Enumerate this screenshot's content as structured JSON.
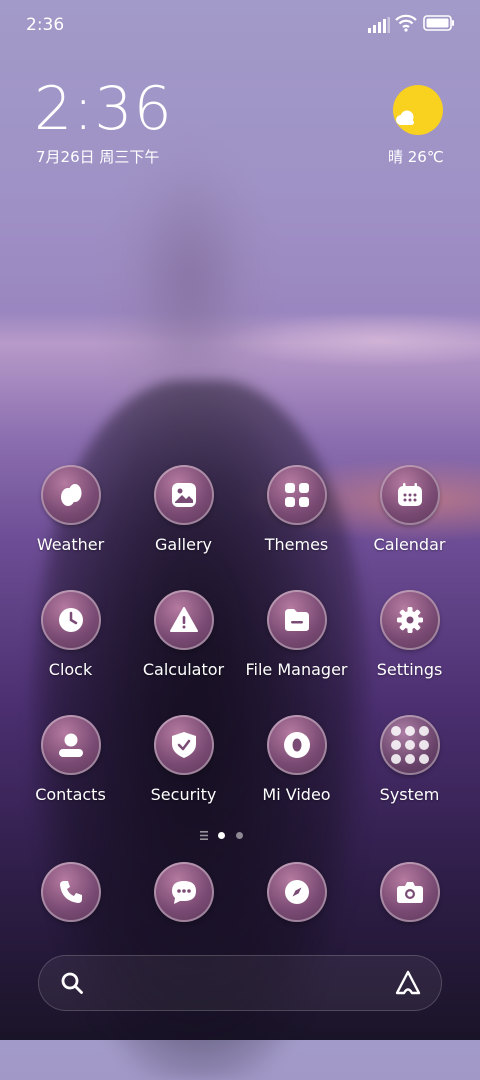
{
  "status_bar": {
    "time": "2:36",
    "icons": [
      "signal-icon",
      "wifi-icon",
      "battery-icon"
    ]
  },
  "clock_widget": {
    "time": "2:36",
    "date": "7月26日 周三下午"
  },
  "weather_widget": {
    "icon": "sun-icon",
    "text": "晴 26℃"
  },
  "apps": [
    {
      "label": "Weather",
      "icon": "weather-icon"
    },
    {
      "label": "Gallery",
      "icon": "gallery-icon"
    },
    {
      "label": "Themes",
      "icon": "themes-icon"
    },
    {
      "label": "Calendar",
      "icon": "calendar-icon"
    },
    {
      "label": "Clock",
      "icon": "clock-icon"
    },
    {
      "label": "Calculator",
      "icon": "calculator-icon"
    },
    {
      "label": "File Manager",
      "icon": "file-manager-icon"
    },
    {
      "label": "Settings",
      "icon": "settings-icon"
    },
    {
      "label": "Contacts",
      "icon": "contacts-icon"
    },
    {
      "label": "Security",
      "icon": "security-icon"
    },
    {
      "label": "Mi Video",
      "icon": "mi-video-icon"
    },
    {
      "label": "System",
      "icon": "folder-icon"
    }
  ],
  "page_indicator": {
    "pages": 2,
    "active": 1
  },
  "dock": [
    {
      "icon": "phone-icon"
    },
    {
      "icon": "messages-icon"
    },
    {
      "icon": "browser-icon"
    },
    {
      "icon": "camera-icon"
    }
  ],
  "search_bar": {
    "icon": "search-icon",
    "assistant_icon": "assistant-icon"
  },
  "colors": {
    "icon_bg": "#7a4b74",
    "accent_sun": "#f9d11f"
  }
}
